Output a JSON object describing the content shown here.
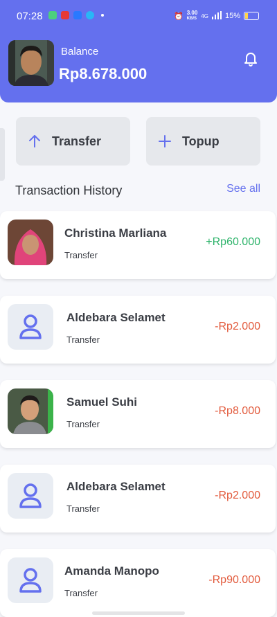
{
  "status_bar": {
    "time": "07:28",
    "net_speed": "3.00",
    "net_unit": "KB/S",
    "network": "4G",
    "battery": "15%"
  },
  "header": {
    "balance_label": "Balance",
    "balance_value": "Rp8.678.000",
    "bell_icon": "bell-icon"
  },
  "actions": {
    "transfer_label": "Transfer",
    "topup_label": "Topup"
  },
  "history": {
    "title": "Transaction History",
    "see_all": "See all"
  },
  "transactions": [
    {
      "name": "Christina Marliana",
      "type": "Transfer",
      "amount": "+Rp60.000",
      "avatar": "photo"
    },
    {
      "name": "Aldebara Selamet",
      "type": "Transfer",
      "amount": "-Rp2.000",
      "avatar": "user-icon"
    },
    {
      "name": "Samuel Suhi",
      "type": "Transfer",
      "amount": "-Rp8.000",
      "avatar": "photo"
    },
    {
      "name": "Aldebara Selamet",
      "type": "Transfer",
      "amount": "-Rp2.000",
      "avatar": "user-icon"
    },
    {
      "name": "Amanda Manopo",
      "type": "Transfer",
      "amount": "-Rp90.000",
      "avatar": "user-icon"
    }
  ],
  "colors": {
    "primary": "#6470ee",
    "positive": "#2db36a",
    "negative": "#e25a3c"
  }
}
